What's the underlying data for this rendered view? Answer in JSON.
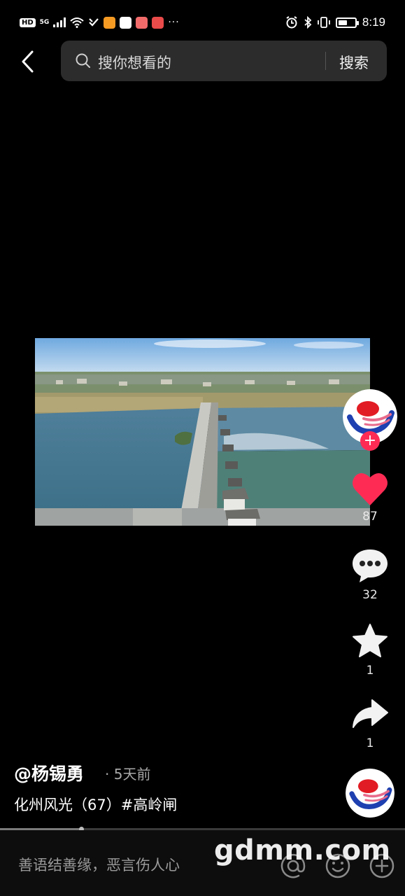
{
  "status_bar": {
    "hd": "HD",
    "network": "5G",
    "time": "8:19",
    "dots": "···",
    "battery_level": 0.55
  },
  "search": {
    "placeholder": "搜你想看的",
    "button_label": "搜索"
  },
  "actions": {
    "likes": "87",
    "comments": "32",
    "favorites": "1",
    "shares": "1"
  },
  "post": {
    "author": "@杨锡勇",
    "time_ago": "· 5天前",
    "caption": "化州风光（67）#高岭闸"
  },
  "playback": {
    "progress": 0.2
  },
  "comment_bar": {
    "placeholder": "善语结善缘，恶言伤人心"
  },
  "watermark": "gdmm.com",
  "colors": {
    "like": "#fe2c55",
    "follow": "#fe2c55",
    "background": "#000000",
    "search_box": "#2c2c2c"
  }
}
